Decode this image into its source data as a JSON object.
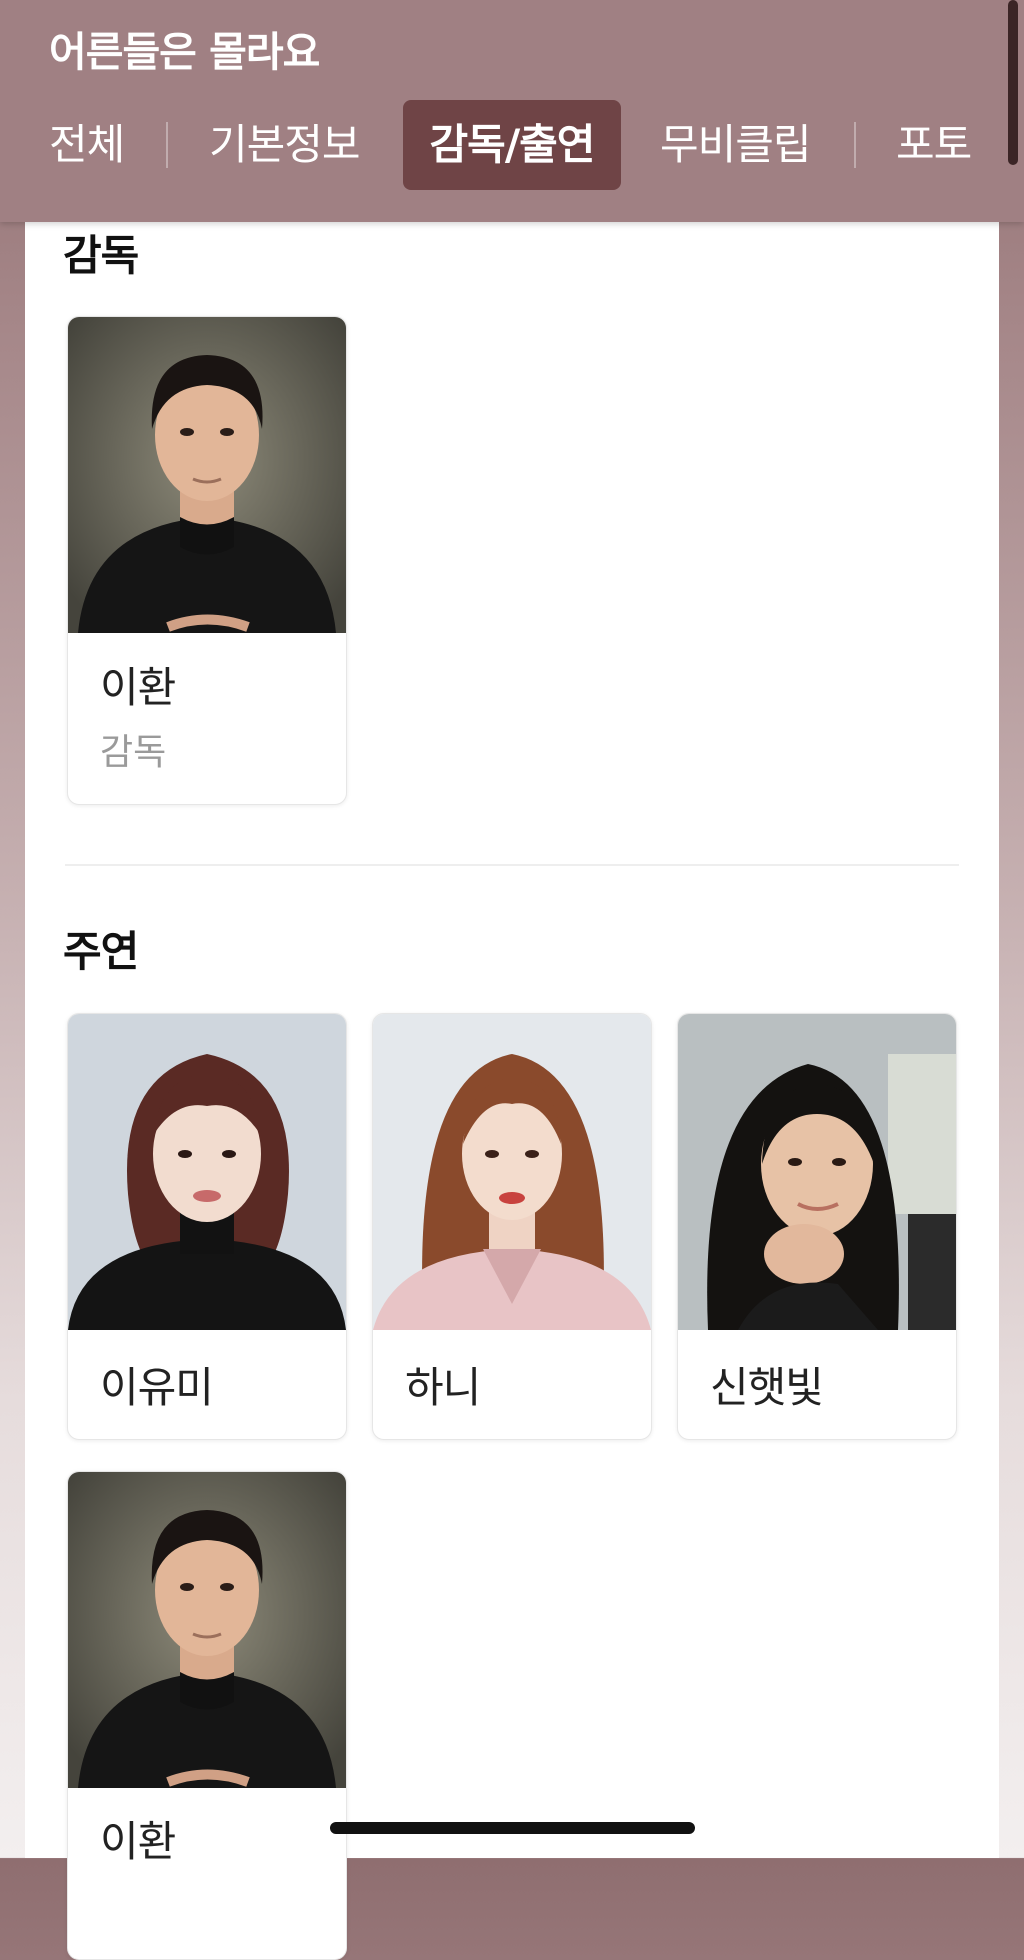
{
  "app": {
    "title": "어른들은 몰라요"
  },
  "tabs": [
    {
      "label": "전체",
      "active": false
    },
    {
      "label": "기본정보",
      "active": false
    },
    {
      "label": "감독/출연",
      "active": true
    },
    {
      "label": "무비클립",
      "active": false
    },
    {
      "label": "포토",
      "active": false
    }
  ],
  "sections": {
    "director": {
      "title": "감독",
      "people": [
        {
          "name": "이환",
          "role": "감독"
        }
      ]
    },
    "lead": {
      "title": "주연",
      "people": [
        {
          "name": "이유미"
        },
        {
          "name": "하니"
        },
        {
          "name": "신햇빛"
        },
        {
          "name": "이환"
        }
      ]
    }
  },
  "colors": {
    "header_bg": "#a08083",
    "active_tab_bg": "#6f4446",
    "text_primary": "#222222",
    "text_secondary": "#9a9a9a"
  }
}
